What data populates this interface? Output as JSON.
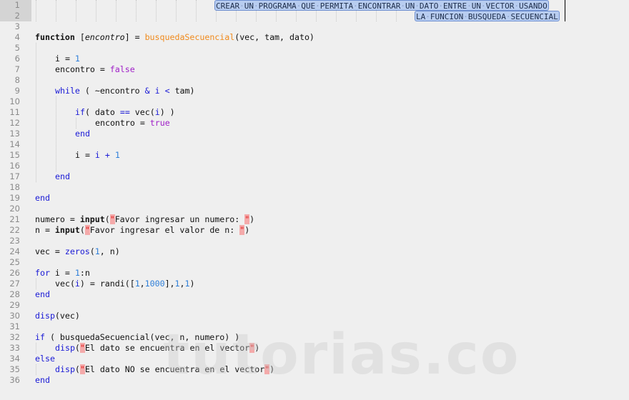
{
  "editor": {
    "line_numbers": [
      "1",
      "2",
      "3",
      "4",
      "5",
      "6",
      "7",
      "8",
      "9",
      "10",
      "11",
      "12",
      "13",
      "14",
      "15",
      "16",
      "17",
      "18",
      "19",
      "20",
      "21",
      "22",
      "23",
      "24",
      "25",
      "26",
      "27",
      "28",
      "29",
      "30",
      "31",
      "32",
      "33",
      "34",
      "35",
      "36"
    ],
    "header_comment": {
      "line1_words": [
        "CREAR",
        "UN",
        "PROGRAMA",
        "QUE",
        "PERMITA",
        "ENCONTRAR",
        "UN",
        "DATO",
        "ENTRE",
        "UN",
        "VECTOR",
        "USANDO"
      ],
      "line2_words": [
        "LA",
        "FUNCION",
        "BUSQUEDA",
        "SECUENCIAL"
      ],
      "space_marker": "·"
    },
    "code": {
      "l4": {
        "kw": "function",
        "open": " [",
        "out": "encontro",
        "mid": "] = ",
        "name": "busquedaSecuencial",
        "args": "(vec, tam, dato)"
      },
      "l6": {
        "a": "i = ",
        "n": "1"
      },
      "l7": {
        "a": "encontro = ",
        "b": "false"
      },
      "l9": {
        "kw": "while",
        "rest": " ( ~encontro ",
        "amp": "&",
        "sp": " ",
        "i": "i",
        "lt": " < ",
        "tail": "tam)"
      },
      "l11": {
        "kw": "if",
        "a": "( dato ",
        "eq": "==",
        "b": " vec(",
        "i": "i",
        "c": ") )"
      },
      "l12": {
        "a": "encontro = ",
        "b": "true"
      },
      "l13": {
        "kw": "end"
      },
      "l15": {
        "a": "i = ",
        "i": "i",
        "plus": " + ",
        "n": "1"
      },
      "l17": {
        "kw": "end"
      },
      "l19": {
        "kw": "end"
      },
      "l21": {
        "a": "numero = ",
        "fn": "input",
        "p": "(",
        "q1": "\"",
        "s": "Favor ingresar un numero: ",
        "q2": "\"",
        "e": ")"
      },
      "l22": {
        "a": "n = ",
        "fn": "input",
        "p": "(",
        "q1": "\"",
        "s": "Favor ingresar el valor de n: ",
        "q2": "\"",
        "e": ")"
      },
      "l24": {
        "a": "vec = ",
        "fn": "zeros",
        "p": "(",
        "n": "1",
        "e": ", n)"
      },
      "l26": {
        "kw": "for",
        "a": " i = ",
        "n": "1",
        "e": ":n"
      },
      "l27": {
        "a": "vec(",
        "i": "i",
        "b": ") = randi([",
        "n1": "1",
        "c": ",",
        "n2": "1000",
        "d": "],",
        "n3": "1",
        "e": ",",
        "n4": "1",
        "f": ")"
      },
      "l28": {
        "kw": "end"
      },
      "l30": {
        "fn": "disp",
        "e": "(vec)"
      },
      "l32": {
        "kw": "if",
        "e": " ( busquedaSecuencial(vec, n, numero) )"
      },
      "l33": {
        "fn": "disp",
        "p": "(",
        "q1": "\"",
        "s": "El dato se encuentra en el vector",
        "q2": "\"",
        "e": ")"
      },
      "l34": {
        "kw": "else"
      },
      "l35": {
        "fn": "disp",
        "p": "(",
        "q1": "\"",
        "s": "El dato NO se encuentra en el vector",
        "q2": "\"",
        "e": ")"
      },
      "l36": {
        "kw": "end"
      }
    }
  },
  "watermark": "tutorias.co"
}
